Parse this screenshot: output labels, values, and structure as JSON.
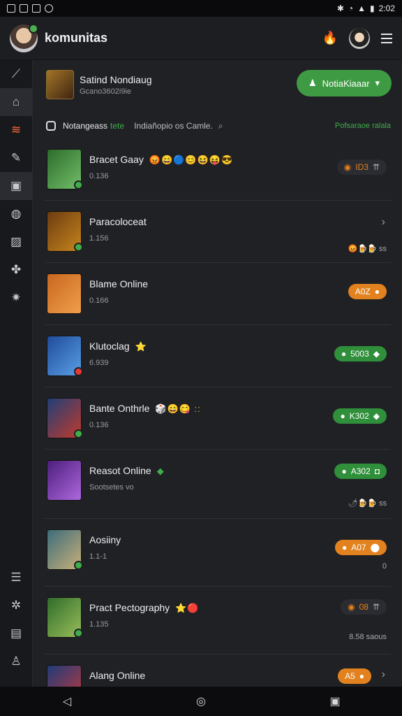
{
  "status": {
    "time": "2:02"
  },
  "appbar": {
    "title": "komunitas"
  },
  "profile": {
    "name": "Satind Nondiaug",
    "subtitle": "Gcano3602i9ie",
    "action_label": "NotiaKiaaar"
  },
  "filter": {
    "label": "Notangeass",
    "tag": "tete",
    "query": "Indiañopio os Camle.",
    "right": "Pofsaraoe ralala"
  },
  "rows": [
    {
      "title": "Bracet Gaay",
      "sub": "0.136",
      "emojis": "😡😄🔵😊😆😝😎",
      "pill": "ID3",
      "pill_style": "dark",
      "side_text": ""
    },
    {
      "title": "Paracoloceat",
      "sub": "1.156",
      "emojis": "",
      "pill": "",
      "pill_style": "",
      "side_text": "😡🍺🍺 ss"
    },
    {
      "title": "Blame Online",
      "sub": "0.166",
      "emojis": "",
      "pill": "A0Z",
      "pill_style": "orange",
      "side_text": ""
    },
    {
      "title": "Klutoclag",
      "sub": "6.939",
      "emojis": "⭐",
      "pill": "5003",
      "pill_style": "green",
      "side_text": ""
    },
    {
      "title": "Bante Onthrle",
      "sub": "0.136",
      "emojis": "🎲😄😋 ::",
      "pill": "K302",
      "pill_style": "green",
      "side_text": ""
    },
    {
      "title": "Reasot Online",
      "sub": "Sootsetes vo",
      "emojis": "◆",
      "pill": "A302",
      "pill_style": "green",
      "side_text": "🌶🍺🍺 ss"
    },
    {
      "title": "Aosiiny",
      "sub": "1.1-1",
      "emojis": "",
      "pill": "A07",
      "pill_style": "orange",
      "side_text": "0"
    },
    {
      "title": "Pract Pectography",
      "sub": "1.135",
      "emojis": "⭐🔴",
      "pill": "08",
      "pill_style": "dark",
      "side_text": "8.58 saous"
    },
    {
      "title": "Alang Online",
      "sub": "",
      "emojis": "",
      "pill": "A5",
      "pill_style": "orange",
      "side_text": ""
    }
  ]
}
